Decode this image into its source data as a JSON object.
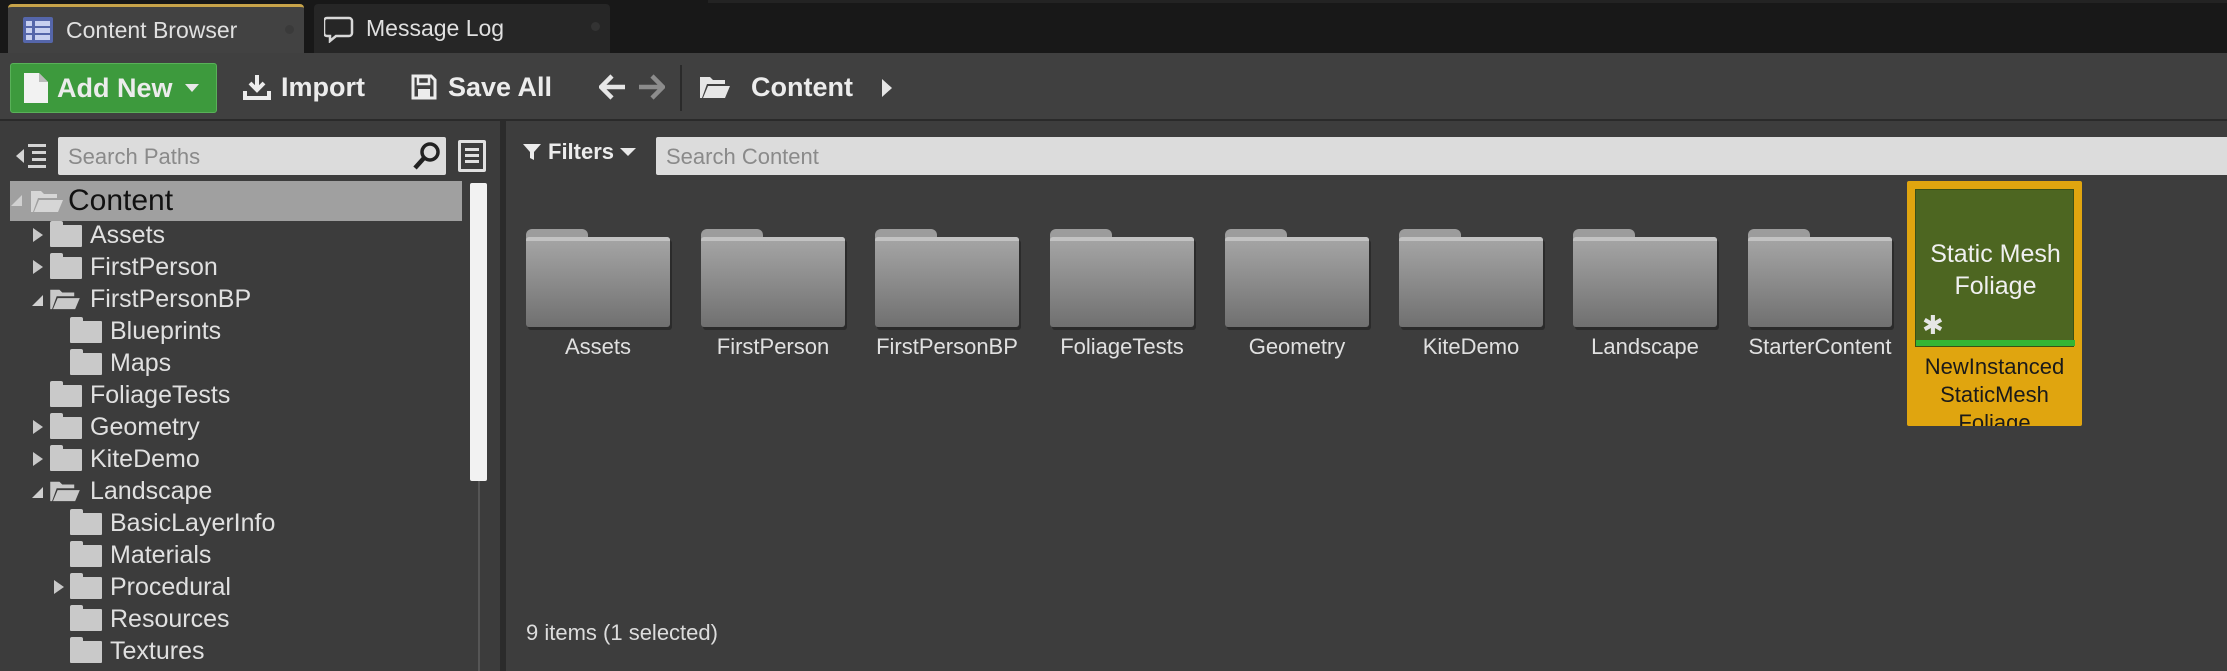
{
  "tabs": [
    {
      "label": "Content Browser",
      "icon": "content-browser-icon",
      "active": true
    },
    {
      "label": "Message Log",
      "icon": "message-log-icon",
      "active": false
    }
  ],
  "toolbar": {
    "add_new": "Add New",
    "import": "Import",
    "save_all": "Save All",
    "breadcrumb": "Content"
  },
  "sources": {
    "search_placeholder": "Search Paths",
    "tree": [
      {
        "label": "Content",
        "expander": "open",
        "selected": true
      },
      {
        "label": "Assets",
        "expander": "closed"
      },
      {
        "label": "FirstPerson",
        "expander": "closed"
      },
      {
        "label": "FirstPersonBP",
        "expander": "open"
      },
      {
        "label": "Blueprints",
        "expander": "none"
      },
      {
        "label": "Maps",
        "expander": "none"
      },
      {
        "label": "FoliageTests",
        "expander": "none"
      },
      {
        "label": "Geometry",
        "expander": "closed"
      },
      {
        "label": "KiteDemo",
        "expander": "closed"
      },
      {
        "label": "Landscape",
        "expander": "open"
      },
      {
        "label": "BasicLayerInfo",
        "expander": "none"
      },
      {
        "label": "Materials",
        "expander": "none"
      },
      {
        "label": "Procedural",
        "expander": "closed"
      },
      {
        "label": "Resources",
        "expander": "none"
      },
      {
        "label": "Textures",
        "expander": "none"
      }
    ]
  },
  "content": {
    "filters_label": "Filters",
    "search_placeholder": "Search Content",
    "folders": [
      "Assets",
      "FirstPerson",
      "FirstPersonBP",
      "FoliageTests",
      "Geometry",
      "KiteDemo",
      "Landscape",
      "StarterContent"
    ],
    "selected_asset": {
      "thumb_label": "Static Mesh Foliage",
      "name": "NewInstanced StaticMesh Foliage"
    },
    "status": "9 items (1 selected)"
  },
  "colors": {
    "add_new": "#3d9a3d",
    "selection": "#e0a50f",
    "thumbnail": "#4d6621",
    "tab_accent": "#c8a44a"
  }
}
